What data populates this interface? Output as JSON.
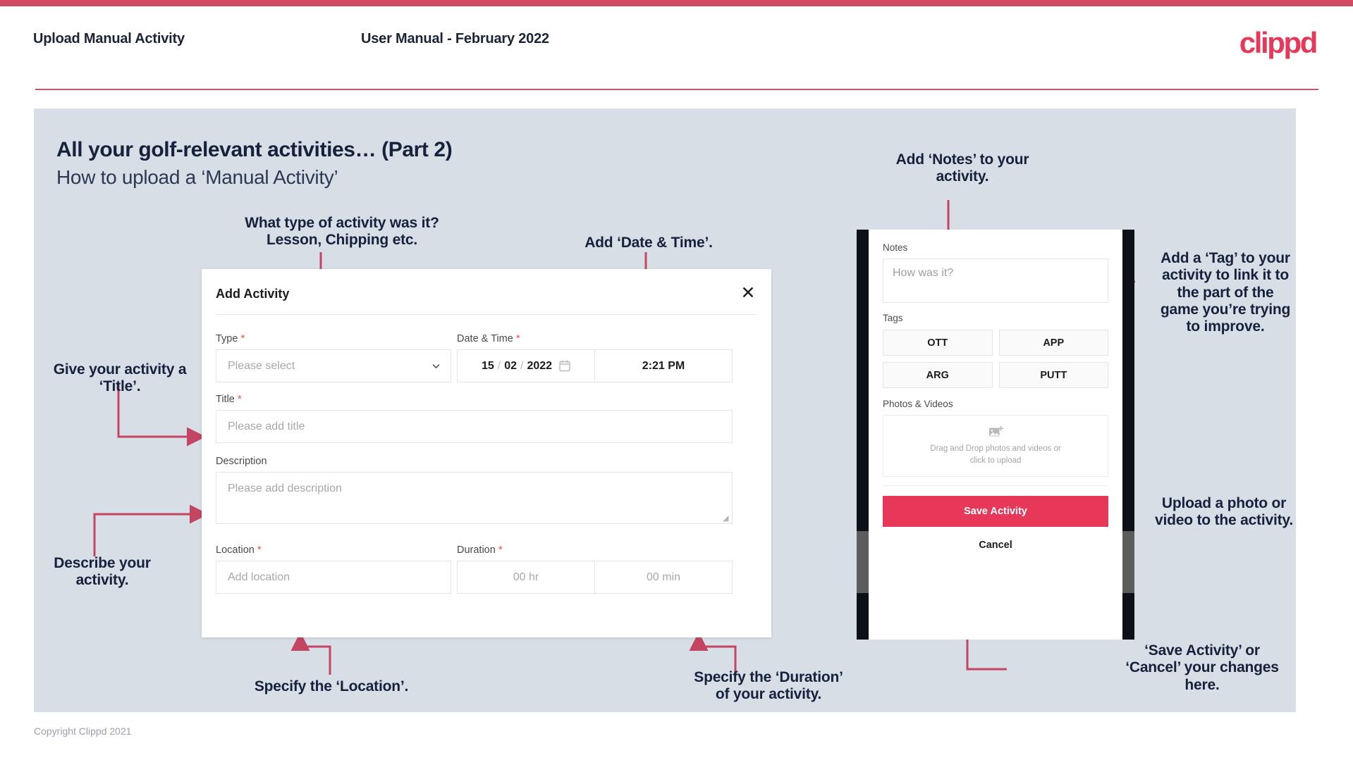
{
  "header": {
    "title": "Upload Manual Activity",
    "subtitle": "User Manual - February 2022",
    "logo": "clippd"
  },
  "slide": {
    "heading": "All your golf-relevant activities… (Part 2)",
    "subheading": "How to upload a ‘Manual Activity’"
  },
  "annotations": {
    "type": "What type of activity was it?\nLesson, Chipping etc.",
    "datetime": "Add ‘Date & Time’.",
    "title": "Give your activity a\n‘Title’.",
    "description": "Describe your\nactivity.",
    "location": "Specify the ‘Location’.",
    "duration": "Specify the ‘Duration’\nof your activity.",
    "notes": "Add ‘Notes’ to your\nactivity.",
    "tags": "Add a ‘Tag’ to your\nactivity to link it to\nthe part of the\ngame you’re trying\nto improve.",
    "photos": "Upload a photo or\nvideo to the activity.",
    "save": "‘Save Activity’ or\n‘Cancel’ your changes\nhere."
  },
  "modal": {
    "title": "Add Activity",
    "close_icon": "close-icon",
    "fields": {
      "type": {
        "label": "Type",
        "required": true,
        "placeholder": "Please select",
        "value": "",
        "icon": "chevron-down-icon"
      },
      "datetime": {
        "label": "Date & Time",
        "required": true,
        "day": "15",
        "month": "02",
        "year": "2022",
        "separator": "/",
        "calendar_icon": "calendar-icon",
        "time": "2:21 PM"
      },
      "title": {
        "label": "Title",
        "required": true,
        "placeholder": "Please add title",
        "value": ""
      },
      "description": {
        "label": "Description",
        "required": false,
        "placeholder": "Please add description",
        "value": ""
      },
      "location": {
        "label": "Location",
        "required": true,
        "placeholder": "Add location",
        "value": ""
      },
      "duration": {
        "label": "Duration",
        "required": true,
        "hours_placeholder": "00 hr",
        "minutes_placeholder": "00 min"
      }
    }
  },
  "phone": {
    "notes": {
      "label": "Notes",
      "placeholder": "How was it?"
    },
    "tags": {
      "label": "Tags",
      "options": [
        "OTT",
        "APP",
        "ARG",
        "PUTT"
      ]
    },
    "photos": {
      "label": "Photos & Videos",
      "icon": "add-image-icon",
      "drop_line1": "Drag and Drop photos and videos or",
      "drop_line2": "click to upload"
    },
    "save_label": "Save Activity",
    "cancel_label": "Cancel"
  },
  "footer": {
    "copyright": "Copyright Clippd 2021"
  },
  "colors": {
    "accent": "#e8385a",
    "accent_bar": "#cf4b63",
    "panel": "#d7dee6",
    "arrow": "#c44561",
    "text_dark": "#16213c"
  }
}
